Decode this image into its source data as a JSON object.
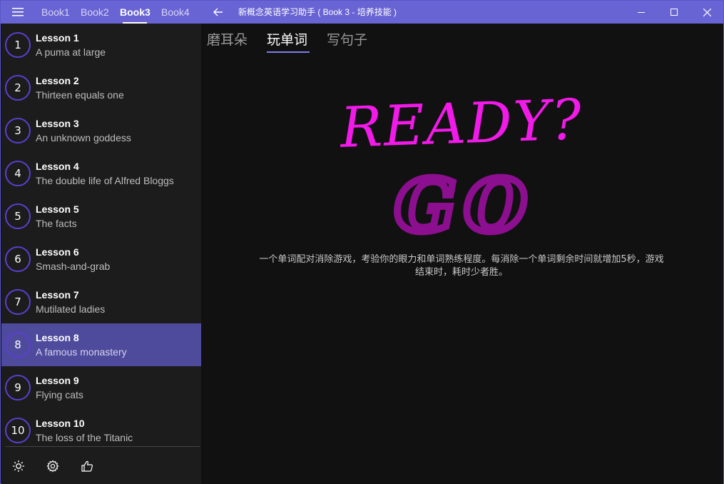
{
  "colors": {
    "accent": "#6964d4",
    "selected": "#4e4b9c",
    "ready": "#f21ae9",
    "go": "#8c0f8f",
    "circle": "#5b3fd0"
  },
  "titlebar": {
    "books": [
      "Book1",
      "Book2",
      "Book3",
      "Book4"
    ],
    "active_book": "Book3",
    "title": "新概念英语学习助手 ( Book 3 - 培养技能 )"
  },
  "sidebar": {
    "lessons": [
      {
        "number": "1",
        "title": "Lesson 1",
        "subtitle": "A puma at large"
      },
      {
        "number": "2",
        "title": "Lesson 2",
        "subtitle": "Thirteen equals one"
      },
      {
        "number": "3",
        "title": "Lesson 3",
        "subtitle": "An unknown goddess"
      },
      {
        "number": "4",
        "title": "Lesson 4",
        "subtitle": "The double life of Alfred Bloggs"
      },
      {
        "number": "5",
        "title": "Lesson 5",
        "subtitle": "The facts"
      },
      {
        "number": "6",
        "title": "Lesson 6",
        "subtitle": "Smash-and-grab"
      },
      {
        "number": "7",
        "title": "Lesson 7",
        "subtitle": "Mutilated ladies"
      },
      {
        "number": "8",
        "title": "Lesson 8",
        "subtitle": "A famous monastery"
      },
      {
        "number": "9",
        "title": "Lesson 9",
        "subtitle": "Flying cats"
      },
      {
        "number": "10",
        "title": "Lesson 10",
        "subtitle": "The loss of the Titanic"
      }
    ],
    "selected_lesson": "8",
    "bottom_icons": [
      "brightness-icon",
      "settings-gear-icon",
      "thumbs-up-icon"
    ]
  },
  "main": {
    "tabs": [
      "磨耳朵",
      "玩单词",
      "写句子"
    ],
    "active_tab": "玩单词",
    "art": {
      "ready_text": "READY?",
      "go_text": "GO"
    },
    "description": "一个单词配对消除游戏，考验你的眼力和单词熟练程度。每消除一个单词剩余时间就增加5秒，游戏结束时，耗时少者胜。"
  }
}
